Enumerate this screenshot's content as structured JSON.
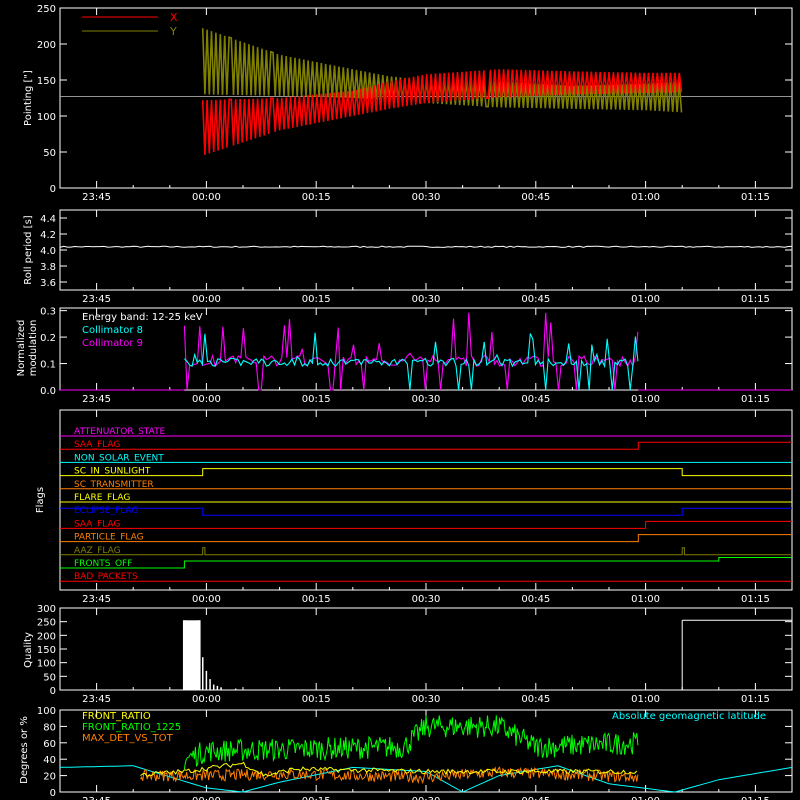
{
  "xaxis": {
    "tick_labels": [
      "23:45",
      "00:00",
      "00:15",
      "00:30",
      "00:45",
      "01:00",
      "01:15"
    ],
    "tick_minutes": [
      -15,
      0,
      15,
      30,
      45,
      60,
      75
    ],
    "range_minutes": [
      -20,
      80
    ]
  },
  "panels": {
    "pointing": {
      "ylabel": "Pointing [\"]",
      "yticks": [
        0,
        50,
        100,
        150,
        200,
        250
      ],
      "ylim": [
        0,
        250
      ],
      "legend": [
        {
          "label": "X",
          "color": "#ff0000"
        },
        {
          "label": "Y",
          "color": "#808000"
        }
      ],
      "reference_level": 127
    },
    "roll": {
      "ylabel": "Roll period [s]",
      "yticks": [
        "3.6",
        "3.8",
        "4.0",
        "4.2",
        "4.4"
      ],
      "ylim": [
        3.5,
        4.5
      ],
      "value": 4.04
    },
    "modulation": {
      "ylabel_line1": "Normalized",
      "ylabel_line2": "modulation",
      "yticks": [
        "0.0",
        "0.1",
        "0.2",
        "0.3"
      ],
      "ylim": [
        0,
        0.31
      ],
      "annotation": "Energy band: 12-25 keV",
      "legend": [
        {
          "label": "Collimator 8",
          "color": "#00ffff"
        },
        {
          "label": "Collimator 9",
          "color": "#ff00ff"
        }
      ],
      "active_minutes": [
        -3,
        59
      ]
    },
    "flags": {
      "ylabel": "Flags",
      "items": [
        {
          "label": "ATTENUATOR_STATE",
          "color": "#ff00ff"
        },
        {
          "label": "SAA_FLAG",
          "color": "#ff0000"
        },
        {
          "label": "NON_SOLAR_EVENT",
          "color": "#00ffff"
        },
        {
          "label": "SC_IN_SUNLIGHT",
          "color": "#ffff00"
        },
        {
          "label": "SC_TRANSMITTER",
          "color": "#ff8000"
        },
        {
          "label": "FLARE_FLAG",
          "color": "#ffff00"
        },
        {
          "label": "ECLIPSE_FLAG",
          "color": "#0000ff"
        },
        {
          "label": "SAA_FLAG",
          "color": "#ff0000"
        },
        {
          "label": "PARTICLE_FLAG",
          "color": "#ff8000"
        },
        {
          "label": "AAZ_FLAG",
          "color": "#808000"
        },
        {
          "label": "FRONTS_OFF",
          "color": "#00ff00"
        },
        {
          "label": "BAD_PACKETS",
          "color": "#ff0000"
        }
      ]
    },
    "quality": {
      "ylabel": "Quality",
      "yticks": [
        0,
        50,
        100,
        150,
        200,
        250,
        300
      ],
      "ylim": [
        0,
        300
      ]
    },
    "ratios": {
      "ylabel": "Degrees or %",
      "yticks": [
        0,
        20,
        40,
        60,
        80,
        100
      ],
      "ylim": [
        0,
        100
      ],
      "legend": [
        {
          "label": "FRONT_RATIO",
          "color": "#ffff00"
        },
        {
          "label": "FRONT_RATIO_1225",
          "color": "#00ff00"
        },
        {
          "label": "MAX_DET_VS_TOT",
          "color": "#ff8000"
        }
      ],
      "geo_label": "Absolute geomagnetic latitude",
      "geo_color": "#00ffff"
    }
  },
  "chart_data": [
    {
      "type": "line",
      "ylabel": "Pointing [\"]",
      "ylim": [
        0,
        250
      ],
      "series": [
        {
          "name": "X",
          "color": "#ff0000",
          "x_minutes": [
            -0.5,
            10,
            20,
            25,
            30,
            40,
            50,
            60,
            65
          ],
          "min": [
            45,
            80,
            100,
            110,
            118,
            126,
            130,
            132,
            133
          ],
          "max": [
            122,
            125,
            135,
            148,
            158,
            165,
            162,
            160,
            160
          ]
        },
        {
          "name": "Y",
          "color": "#808000",
          "x_minutes": [
            -0.5,
            10,
            20,
            25,
            30,
            40,
            50,
            60,
            65
          ],
          "min": [
            130,
            128,
            125,
            122,
            118,
            112,
            110,
            108,
            105
          ],
          "max": [
            222,
            185,
            165,
            155,
            150,
            148,
            142,
            145,
            148
          ]
        }
      ]
    },
    {
      "type": "line",
      "ylabel": "Roll period [s]",
      "ylim": [
        3.5,
        4.5
      ],
      "series": [
        {
          "x_minutes": [
            -20,
            80
          ],
          "values": [
            4.04,
            4.04
          ]
        }
      ]
    },
    {
      "type": "line",
      "ylabel": "Normalized modulation",
      "ylim": [
        0,
        0.31
      ],
      "series": [
        {
          "name": "Collimator 8",
          "color": "#00ffff",
          "typical": 0.1,
          "peak": 0.2
        },
        {
          "name": "Collimator 9",
          "color": "#ff00ff",
          "typical": 0.1,
          "peak": 0.3
        }
      ]
    },
    {
      "type": "line",
      "ylabel": "Flags",
      "series": [
        {
          "name": "ATTENUATOR_STATE",
          "values": [
            [
              -20,
              0
            ]
          ]
        },
        {
          "name": "SAA_FLAG",
          "values": [
            [
              -20,
              0
            ],
            [
              59,
              1
            ],
            [
              80,
              1
            ]
          ]
        },
        {
          "name": "NON_SOLAR_EVENT",
          "values": [
            [
              -20,
              0
            ]
          ]
        },
        {
          "name": "SC_IN_SUNLIGHT",
          "values": [
            [
              -20,
              0
            ],
            [
              -0.5,
              1
            ],
            [
              65,
              0
            ]
          ]
        },
        {
          "name": "SC_TRANSMITTER",
          "values": [
            [
              -20,
              0
            ]
          ]
        },
        {
          "name": "FLARE_FLAG",
          "values": [
            [
              -20,
              0
            ]
          ]
        },
        {
          "name": "ECLIPSE_FLAG",
          "values": [
            [
              -20,
              1
            ],
            [
              -0.5,
              0
            ],
            [
              65,
              1
            ]
          ]
        },
        {
          "name": "SAA_FLAG",
          "values": [
            [
              -20,
              0
            ],
            [
              60,
              1
            ]
          ]
        },
        {
          "name": "PARTICLE_FLAG",
          "values": [
            [
              -20,
              0
            ],
            [
              59,
              1
            ]
          ]
        },
        {
          "name": "AAZ_FLAG",
          "values": [
            [
              -20,
              0
            ],
            [
              -0.5,
              1
            ],
            [
              -0.2,
              0
            ],
            [
              65,
              1
            ],
            [
              65.3,
              0
            ]
          ]
        },
        {
          "name": "FRONTS_OFF",
          "values": [
            [
              -20,
              0
            ],
            [
              -3,
              1
            ],
            [
              70,
              1.5
            ],
            [
              79,
              1.5
            ]
          ]
        },
        {
          "name": "BAD_PACKETS",
          "values": [
            [
              -20,
              0
            ]
          ]
        }
      ]
    },
    {
      "type": "bar",
      "ylabel": "Quality",
      "ylim": [
        0,
        300
      ],
      "series": [
        {
          "x_minutes": [
            -3,
            -1,
            -0.5,
            0,
            0.5,
            1,
            1.5,
            2,
            4,
            65,
            66,
            80
          ],
          "values": [
            255,
            255,
            120,
            70,
            40,
            20,
            15,
            10,
            5,
            255,
            255,
            255
          ]
        }
      ]
    },
    {
      "type": "line",
      "ylabel": "Degrees or %",
      "ylim": [
        0,
        100
      ],
      "series": [
        {
          "name": "FRONT_RATIO",
          "color": "#ffff00",
          "x_minutes": [
            -9,
            -3,
            5,
            8,
            12,
            30,
            59
          ],
          "values": [
            21,
            25,
            35,
            20,
            28,
            25,
            25
          ]
        },
        {
          "name": "FRONT_RATIO_1225",
          "color": "#00ff00",
          "x_minutes": [
            -3,
            0,
            10,
            27,
            30,
            40,
            45,
            59
          ],
          "values": [
            40,
            50,
            52,
            55,
            80,
            80,
            55,
            60
          ]
        },
        {
          "name": "MAX_DET_VS_TOT",
          "color": "#ff8000",
          "x_minutes": [
            -9,
            0,
            10,
            20,
            30,
            40,
            50,
            59
          ],
          "values": [
            20,
            20,
            22,
            20,
            18,
            24,
            21,
            18
          ]
        },
        {
          "name": "Absolute geomagnetic latitude",
          "color": "#00ffff",
          "x_minutes": [
            -20,
            -10,
            0,
            5,
            10,
            20,
            30,
            35,
            40,
            48,
            55,
            64,
            70,
            80
          ],
          "values": [
            30,
            32,
            5,
            0,
            12,
            30,
            25,
            0,
            20,
            32,
            10,
            0,
            15,
            30
          ]
        }
      ]
    }
  ]
}
